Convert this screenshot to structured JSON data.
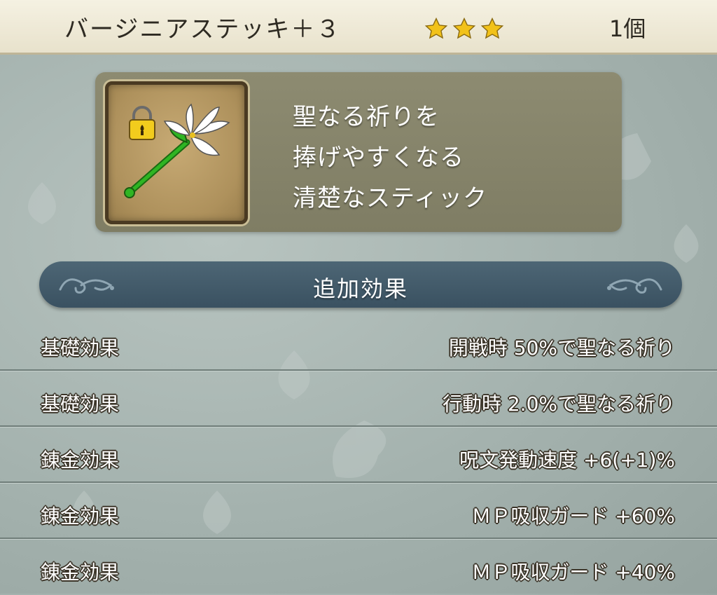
{
  "header": {
    "item_name": "バージニアステッキ＋３",
    "rarity_stars": 3,
    "count_label": "1個"
  },
  "description": {
    "lines": [
      "聖なる祈りを",
      "捧げやすくなる",
      "清楚なスティック"
    ]
  },
  "item_icon": {
    "name": "lily-staff-icon",
    "locked": true
  },
  "section": {
    "title": "追加効果"
  },
  "effects": [
    {
      "label": "基礎効果",
      "value": "開戦時  50%で聖なる祈り"
    },
    {
      "label": "基礎効果",
      "value": "行動時  2.0%で聖なる祈り"
    },
    {
      "label": "錬金効果",
      "value": "呪文発動速度  +6(+1)%"
    },
    {
      "label": "錬金効果",
      "value": "ＭＰ吸収ガード  +60%"
    },
    {
      "label": "錬金効果",
      "value": "ＭＰ吸収ガード  +40%"
    }
  ],
  "colors": {
    "star": "#f2c21a",
    "section_bar": "#3f5666",
    "panel": "#858369"
  }
}
